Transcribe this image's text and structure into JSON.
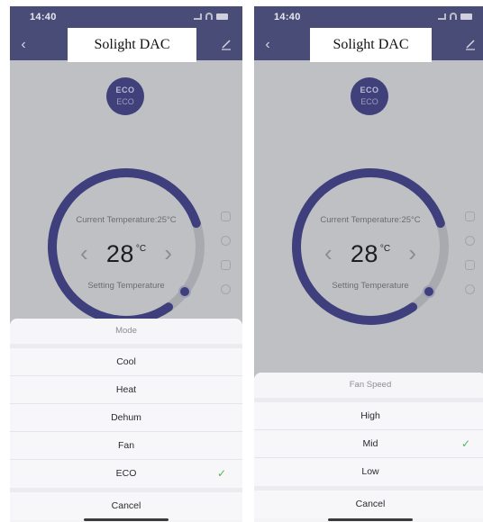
{
  "screens": [
    {
      "status_time": "14:40",
      "title": "Solight DAC",
      "mode_badge": {
        "line1": "ECO",
        "line2": "ECO"
      },
      "current_temperature": "Current Temperature:25°C",
      "set_temperature": "28",
      "temp_unit": "°C",
      "setting_label": "Setting Temperature",
      "sheet": {
        "title": "Mode",
        "options": [
          "Cool",
          "Heat",
          "Dehum",
          "Fan",
          "ECO"
        ],
        "selected": "ECO",
        "cancel": "Cancel"
      }
    },
    {
      "status_time": "14:40",
      "title": "Solight DAC",
      "mode_badge": {
        "line1": "ECO",
        "line2": "ECO"
      },
      "current_temperature": "Current Temperature:25°C",
      "set_temperature": "28",
      "temp_unit": "°C",
      "setting_label": "Setting Temperature",
      "sheet": {
        "title": "Fan Speed",
        "options": [
          "High",
          "Mid",
          "Low"
        ],
        "selected": "Mid",
        "cancel": "Cancel"
      }
    }
  ],
  "icons": {
    "back": "back-arrow-icon",
    "edit": "edit-pencil-icon",
    "decrease": "chevron-left-icon",
    "increase": "chevron-right-icon",
    "selected": "checkmark-icon"
  },
  "colors": {
    "header": "#4a4c78",
    "dial": "#3e3f7c",
    "dial_track": "#a9aab0",
    "check": "#4fb85a"
  }
}
